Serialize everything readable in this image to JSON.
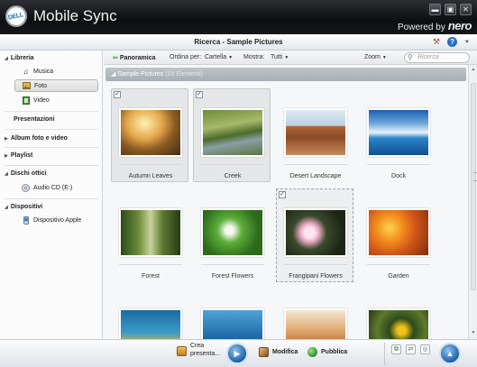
{
  "window": {
    "logo_text": "DELL",
    "title": "Mobile Sync",
    "powered_by": "Powered by",
    "powered_brand": "nero",
    "btn_minimize": "▬",
    "btn_maximize": "▣",
    "btn_close": "✕"
  },
  "header": {
    "breadcrumb": "Ricerca - Sample Pictures",
    "help": "?"
  },
  "sidebar": {
    "libreria": "Libreria",
    "musica": "Musica",
    "foto": "Foto",
    "video": "Video",
    "presentazioni": "Presentazioni",
    "album": "Album foto e video",
    "playlist": "Playlist",
    "dischi": "Dischi ottici",
    "audio_cd": "Audio CD (E:)",
    "dispositivi": "Dispositivi",
    "apple": "Dispositivo Apple"
  },
  "toolbar": {
    "panoramica": "Panoramica",
    "ordina_label": "Ordina per:",
    "ordina_value": "Cartella",
    "mostra_label": "Mostra:",
    "mostra_value": "Tutti",
    "zoom": "Zoom",
    "search_placeholder": "Ricerca"
  },
  "group": {
    "name": "Sample Pictures",
    "count": "(15 Elementi)"
  },
  "items": [
    {
      "caption": "Autumn Leaves",
      "checked": true
    },
    {
      "caption": "Creek",
      "checked": true
    },
    {
      "caption": "Desert Landscape",
      "checked": false
    },
    {
      "caption": "Dock",
      "checked": false
    },
    {
      "caption": "Forest",
      "checked": false
    },
    {
      "caption": "Forest Flowers",
      "checked": false
    },
    {
      "caption": "Frangipani Flowers",
      "checked": true
    },
    {
      "caption": "Garden",
      "checked": false
    },
    {
      "caption": "",
      "checked": false
    },
    {
      "caption": "",
      "checked": false
    },
    {
      "caption": "",
      "checked": false
    },
    {
      "caption": "",
      "checked": false
    }
  ],
  "bottombar": {
    "crea_line1": "Crea",
    "crea_line2": "presenta...",
    "modifica": "Modifica",
    "pubblica": "Pubblica",
    "play": "▶",
    "up": "▲"
  }
}
